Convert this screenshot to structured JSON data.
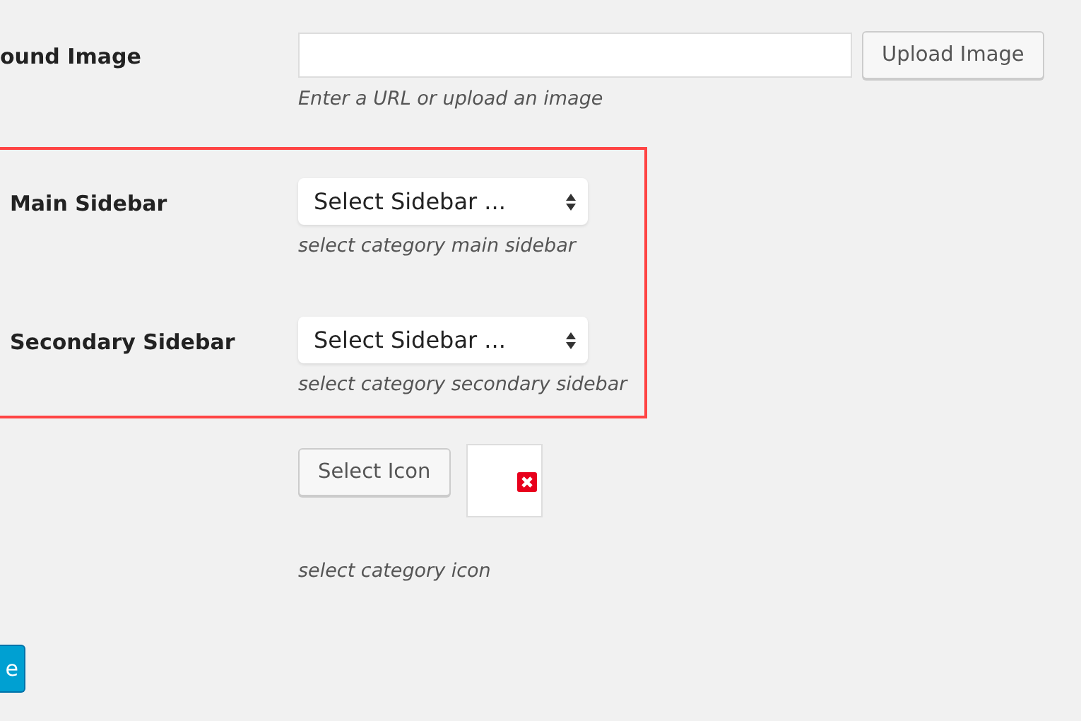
{
  "fields": [
    {
      "kind": "upload",
      "label": "ound Image",
      "button": "Upload Image",
      "hint": "Enter a URL or upload an image",
      "highlighted": false
    },
    {
      "kind": "select",
      "label": "Main Sidebar",
      "value": "Select Sidebar ...",
      "hint": "select category main sidebar",
      "highlighted": true
    },
    {
      "kind": "select",
      "label": "Secondary Sidebar",
      "value": "Select Sidebar ...",
      "hint": "select category secondary sidebar",
      "highlighted": true
    },
    {
      "kind": "icon",
      "button": "Select Icon",
      "hint": "select category icon",
      "highlighted": false
    }
  ],
  "submit": "e"
}
